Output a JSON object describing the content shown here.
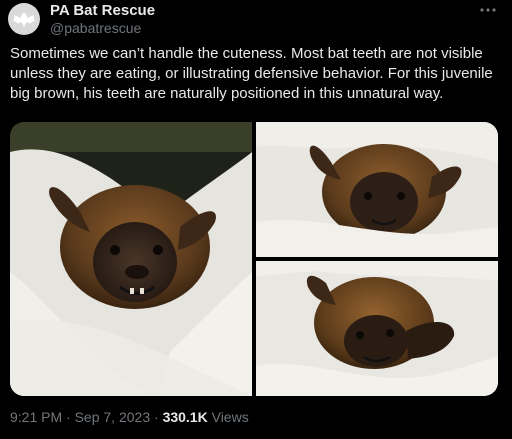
{
  "author": {
    "name": "PA Bat Rescue",
    "handle": "@pabatrescue",
    "avatar_icon": "bat-logo-icon"
  },
  "tweet": {
    "text": "Sometimes we can’t handle the cuteness. Most bat teeth are not visible unless they are eating, or illustrating defensive behavior. For this juvenile big brown, his teeth are naturally positioned in this unnatural way."
  },
  "media": {
    "photos": [
      {
        "icon": "bat-photo-1"
      },
      {
        "icon": "bat-photo-2"
      },
      {
        "icon": "bat-photo-3"
      }
    ]
  },
  "meta": {
    "time": "9:21 PM",
    "separator": "·",
    "date": "Sep 7, 2023",
    "views_count": "330.1K",
    "views_label": "Views"
  },
  "icons": {
    "more": "more-options-icon"
  },
  "colors": {
    "background": "#000000",
    "text_primary": "#e7e9ea",
    "text_secondary": "#71767b"
  }
}
